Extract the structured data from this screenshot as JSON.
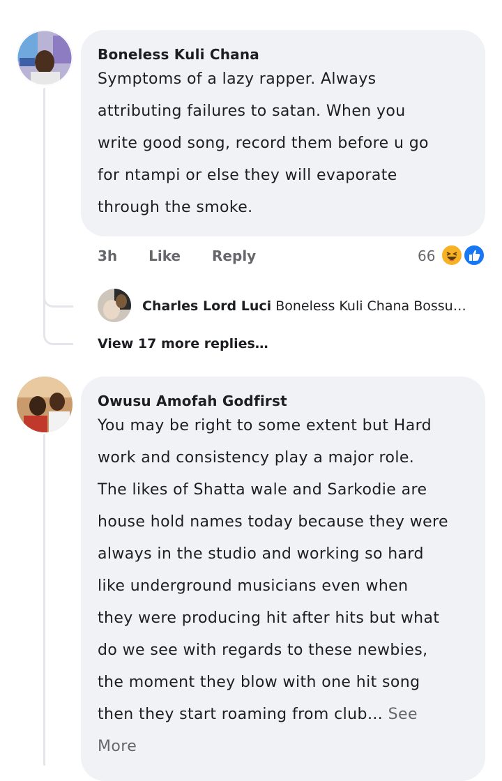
{
  "comments": [
    {
      "author": "Boneless Kuli Chana",
      "lines": [
        "Symptoms of a lazy rapper. Always",
        "attributing failures to satan. When you",
        "write good song, record them before u go",
        "for ntampi or else they will evaporate",
        "through the smoke."
      ],
      "time": "3h",
      "like_label": "Like",
      "reply_label": "Reply",
      "reaction_count": "66",
      "reactions": [
        "haha-icon",
        "like-icon"
      ],
      "reply_preview": {
        "author": "Charles Lord Luci",
        "text": "Boneless Kuli Chana Bossu…"
      },
      "view_more": "View 17 more replies…"
    },
    {
      "author": "Owusu Amofah Godfirst",
      "lines": [
        "You may be right to some extent but Hard",
        "work and consistency play a major role.",
        "The likes of Shatta wale and Sarkodie are",
        "house hold names today because they were",
        "always in the studio and working so hard",
        "like underground musicians even when",
        "they were producing hit after hits but what",
        "do we see with regards to these newbies,",
        "the moment they blow with one hit song",
        "then they start roaming from club…"
      ],
      "see_more_1": "See",
      "see_more_2": "More"
    }
  ],
  "colors": {
    "bubble": "#f0f2f5",
    "meta": "#65676b",
    "like_blue": "#1877f2",
    "haha_yellow": "#f7b125"
  }
}
